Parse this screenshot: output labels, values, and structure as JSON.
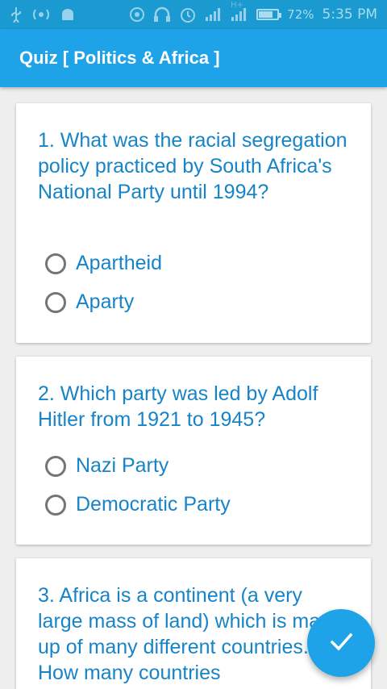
{
  "status_bar": {
    "battery_percent": "72%",
    "time": "5:35 PM",
    "network_type": "H+",
    "icons": [
      "usb-icon",
      "wifi-hotspot-icon",
      "android-icon",
      "nfc-icon",
      "headset-icon",
      "alarm-icon",
      "signal-icon",
      "signal-2-icon",
      "battery-icon"
    ]
  },
  "app_bar": {
    "title": "Quiz [ Politics & Africa ]"
  },
  "questions": [
    {
      "text": "1. What was the racial segregation policy practiced by South Africa's National Party until 1994?",
      "options": [
        "Apartheid",
        "Aparty"
      ]
    },
    {
      "text": "2. Which party was led by Adolf Hitler from 1921 to 1945?",
      "options": [
        "Nazi Party",
        "Democratic Party"
      ]
    },
    {
      "text": "3. Africa is a continent (a very large mass of land) which is made up of many different countries. How many countries",
      "options": []
    }
  ],
  "fab": {
    "icon": "check-icon"
  },
  "colors": {
    "primary": "#1ea3e8",
    "status_bar": "#1a9ad0",
    "text_accent": "#1784c7"
  }
}
